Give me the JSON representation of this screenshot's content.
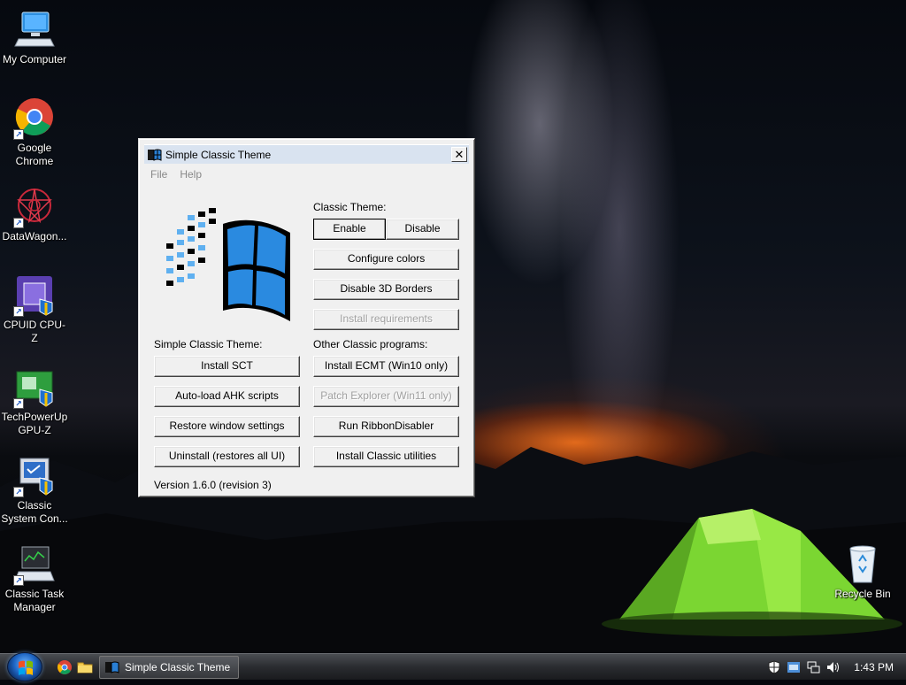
{
  "desktop": {
    "icons": [
      {
        "label": "My Computer"
      },
      {
        "label": "Google Chrome"
      },
      {
        "label": "DataWagon..."
      },
      {
        "label": "CPUID CPU-Z"
      },
      {
        "label": "TechPowerUp GPU-Z"
      },
      {
        "label": "Classic System Con..."
      },
      {
        "label": "Classic Task Manager"
      },
      {
        "label": "Recycle Bin"
      }
    ]
  },
  "window": {
    "title": "Simple Classic Theme",
    "menu": [
      "File",
      "Help"
    ],
    "classic_theme_label": "Classic Theme:",
    "enable_label": "Enable",
    "disable_label": "Disable",
    "configure_colors_label": "Configure colors",
    "disable_3d_borders_label": "Disable 3D Borders",
    "install_requirements_label": "Install requirements",
    "sct_label": "Simple Classic Theme:",
    "other_label": "Other Classic programs:",
    "install_sct_label": "Install SCT",
    "install_ecmt_label": "Install ECMT (Win10 only)",
    "autoload_ahk_label": "Auto-load AHK scripts",
    "patch_explorer_label": "Patch Explorer (Win11 only)",
    "restore_window_label": "Restore window settings",
    "run_ribbon_label": "Run RibbonDisabler",
    "uninstall_label": "Uninstall (restores all UI)",
    "install_utilities_label": "Install Classic utilities",
    "version": "Version 1.6.0 (revision 3)"
  },
  "taskbar": {
    "task_title": "Simple Classic Theme",
    "clock": "1:43 PM"
  },
  "colors": {
    "titlebar": "#d9e3f0",
    "window_face": "#f0f0f0",
    "accent_blue": "#2a7fd4"
  }
}
